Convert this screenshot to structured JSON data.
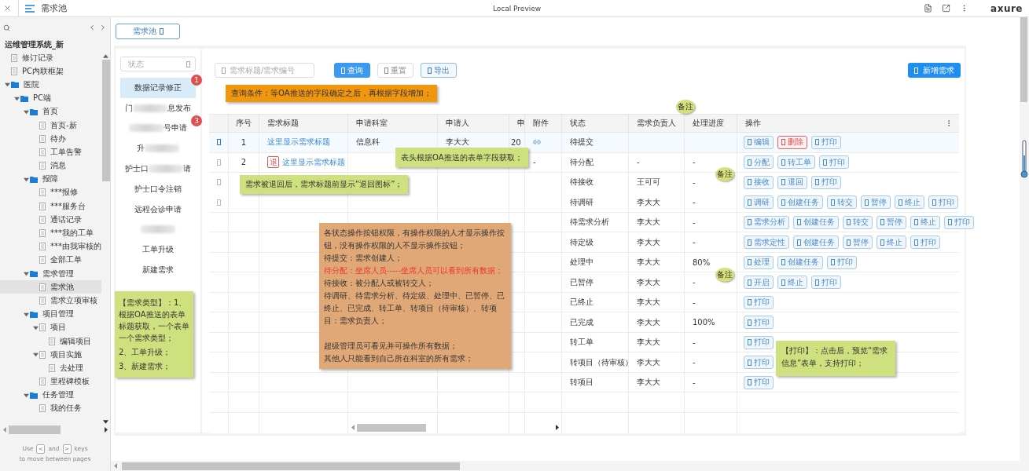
{
  "topbar": {
    "page_title": "需求池",
    "center_title": "Local Preview",
    "logo": "axure"
  },
  "sidebar": {
    "project_title": "运维管理系统_新",
    "tree": [
      {
        "label": "修订记录",
        "kind": "page",
        "selected": false
      },
      {
        "label": "PC内联框架",
        "kind": "page",
        "selected": false
      },
      {
        "label": "医院",
        "kind": "folder",
        "expanded": true,
        "selected": false,
        "children": [
          {
            "label": "PC端",
            "kind": "folder",
            "expanded": true,
            "selected": false,
            "children": [
              {
                "label": "首页",
                "kind": "folder",
                "expanded": true,
                "selected": false,
                "children": [
                  {
                    "label": "首页-新",
                    "kind": "page",
                    "selected": false
                  },
                  {
                    "label": "待办",
                    "kind": "page",
                    "selected": false
                  },
                  {
                    "label": "工单告警",
                    "kind": "page",
                    "selected": false
                  },
                  {
                    "label": "消息",
                    "kind": "page",
                    "selected": false
                  }
                ]
              },
              {
                "label": "报障",
                "kind": "folder",
                "expanded": true,
                "selected": false,
                "children": [
                  {
                    "label": "***报修",
                    "kind": "page",
                    "selected": false
                  },
                  {
                    "label": "***服务台",
                    "kind": "page",
                    "selected": false
                  },
                  {
                    "label": "通话记录",
                    "kind": "page",
                    "selected": false
                  },
                  {
                    "label": "***我的工单",
                    "kind": "page",
                    "selected": false
                  },
                  {
                    "label": "***由我审核的",
                    "kind": "page",
                    "selected": false
                  },
                  {
                    "label": "全部工单",
                    "kind": "page",
                    "selected": false
                  }
                ]
              },
              {
                "label": "需求管理",
                "kind": "folder",
                "expanded": true,
                "selected": false,
                "children": [
                  {
                    "label": "需求池",
                    "kind": "page",
                    "selected": true
                  },
                  {
                    "label": "需求立项审核",
                    "kind": "page",
                    "selected": false
                  }
                ]
              },
              {
                "label": "项目管理",
                "kind": "folder",
                "expanded": true,
                "selected": false,
                "children": [
                  {
                    "label": "项目",
                    "kind": "page",
                    "expanded": true,
                    "selected": false,
                    "children": [
                      {
                        "label": "编辑项目",
                        "kind": "page",
                        "selected": false
                      }
                    ]
                  },
                  {
                    "label": "项目实施",
                    "kind": "page",
                    "expanded": true,
                    "selected": false,
                    "children": [
                      {
                        "label": "去处理",
                        "kind": "page",
                        "selected": false
                      }
                    ]
                  },
                  {
                    "label": "里程碑模板",
                    "kind": "page",
                    "selected": false
                  }
                ]
              },
              {
                "label": "任务管理",
                "kind": "folder",
                "expanded": true,
                "selected": false,
                "children": [
                  {
                    "label": "我的任务",
                    "kind": "page",
                    "selected": false
                  }
                ]
              }
            ]
          }
        ]
      }
    ],
    "footer": {
      "use": "Use",
      "prev_key": "<",
      "and": "and",
      "next_key": ">",
      "keys": "keys",
      "line2": "to move between pages"
    }
  },
  "tab": {
    "label": "需求池",
    "selected": true
  },
  "left_panel": {
    "filter": {
      "placeholder": "状态"
    },
    "items": [
      {
        "selected": true,
        "badge": "1",
        "segments": [
          {
            "kind": "text",
            "text": "数据记录修正"
          }
        ]
      },
      {
        "selected": false,
        "segments": [
          {
            "kind": "text",
            "text": "门"
          },
          {
            "kind": "blur"
          },
          {
            "kind": "text",
            "text": "息发布"
          }
        ]
      },
      {
        "selected": false,
        "badge": "3",
        "segments": [
          {
            "kind": "blur"
          },
          {
            "kind": "text",
            "text": "号申请"
          }
        ]
      },
      {
        "selected": false,
        "segments": [
          {
            "kind": "text",
            "text": "升"
          },
          {
            "kind": "blur"
          }
        ]
      },
      {
        "selected": false,
        "segments": [
          {
            "kind": "text",
            "text": "护士口"
          },
          {
            "kind": "blur"
          },
          {
            "kind": "text",
            "text": "请"
          }
        ]
      },
      {
        "selected": false,
        "segments": [
          {
            "kind": "text",
            "text": "护士口令注销"
          }
        ]
      },
      {
        "selected": false,
        "segments": [
          {
            "kind": "text",
            "text": "远程会诊申请"
          }
        ]
      },
      {
        "selected": false,
        "segments": [
          {
            "kind": "blur"
          }
        ]
      },
      {
        "selected": false,
        "segments": [
          {
            "kind": "text",
            "text": "工单升级"
          }
        ]
      },
      {
        "selected": false,
        "segments": [
          {
            "kind": "text",
            "text": "新建需求"
          }
        ]
      }
    ],
    "note": {
      "text": "【需求类型】：1、根据OA推送的表单标题获取，一个表单一个需求类型；",
      "lines": [
        "2、工单升级；",
        "3、新建需求；"
      ]
    }
  },
  "toolbar": {
    "search": {
      "placeholder": "需求标题/需求编号"
    },
    "buttons": [
      {
        "label": "查询",
        "kind": "primary"
      },
      {
        "label": "重置",
        "kind": "default"
      },
      {
        "label": "导出",
        "kind": "outline"
      }
    ],
    "add_button": {
      "label": "新增需求"
    },
    "note": "查询条件：等OA推送的字段确定之后，再根据字段增加；"
  },
  "table": {
    "columns": [
      "序号",
      "需求标题",
      "申请科室",
      "申请人",
      "申",
      "附件",
      "状态",
      "需求负责人",
      "处理进度",
      "操作"
    ],
    "rows": [
      {
        "selected": true,
        "no": "1",
        "title": "这里显示需求标题",
        "department": "信息科",
        "applicant": "李大大",
        "date": "20",
        "attachment_link": true,
        "status": "待提交",
        "actions": [
          {
            "label": "编辑",
            "kind": "default"
          },
          {
            "label": "删除",
            "kind": "danger"
          },
          {
            "label": "打印",
            "kind": "default"
          }
        ]
      },
      {
        "selected": false,
        "no": "2",
        "return_tag": "退",
        "title": "这里显示需求标题",
        "attachment": "-",
        "status": "待分配",
        "owner": "-",
        "progress": "-",
        "actions": [
          {
            "label": "分配",
            "kind": "default"
          },
          {
            "label": "转工单",
            "kind": "default"
          },
          {
            "label": "打印",
            "kind": "default"
          }
        ]
      },
      {
        "selected": false,
        "status": "待接收",
        "owner": "王可可",
        "progress": "-",
        "actions": [
          {
            "label": "接收",
            "kind": "default"
          },
          {
            "label": "退回",
            "kind": "default"
          },
          {
            "label": "打印",
            "kind": "default"
          }
        ]
      },
      {
        "selected": false,
        "status": "待调研",
        "owner": "李大大",
        "progress": "-",
        "actions": [
          {
            "label": "调研",
            "kind": "default"
          },
          {
            "label": "创建任务",
            "kind": "default"
          },
          {
            "label": "转交",
            "kind": "default"
          },
          {
            "label": "暂停",
            "kind": "default"
          },
          {
            "label": "终止",
            "kind": "default"
          },
          {
            "label": "打印",
            "kind": "default"
          }
        ]
      },
      {
        "status": "待需求分析",
        "owner": "李大大",
        "progress": "-",
        "actions": [
          {
            "label": "需求分析",
            "kind": "default"
          },
          {
            "label": "创建任务",
            "kind": "default"
          },
          {
            "label": "转交",
            "kind": "default"
          },
          {
            "label": "暂停",
            "kind": "default"
          },
          {
            "label": "终止",
            "kind": "default"
          },
          {
            "label": "打印",
            "kind": "default"
          }
        ]
      },
      {
        "status": "待定级",
        "owner": "李大大",
        "progress": "-",
        "actions": [
          {
            "label": "需求定性",
            "kind": "default"
          },
          {
            "label": "创建任务",
            "kind": "default"
          },
          {
            "label": "暂停",
            "kind": "default"
          },
          {
            "label": "终止",
            "kind": "default"
          },
          {
            "label": "打印",
            "kind": "default"
          }
        ]
      },
      {
        "status": "处理中",
        "owner": "李大大",
        "progress": "80%",
        "actions": [
          {
            "label": "处理",
            "kind": "default"
          },
          {
            "label": "创建任务",
            "kind": "default"
          },
          {
            "label": "打印",
            "kind": "default"
          }
        ]
      },
      {
        "status": "已暂停",
        "owner": "李大大",
        "progress": "-",
        "actions": [
          {
            "label": "开启",
            "kind": "default"
          },
          {
            "label": "终止",
            "kind": "default"
          },
          {
            "label": "打印",
            "kind": "default"
          }
        ]
      },
      {
        "status": "已终止",
        "owner": "李大大",
        "progress": "-",
        "actions": [
          {
            "label": "打印",
            "kind": "default"
          }
        ]
      },
      {
        "status": "已完成",
        "owner": "李大大",
        "progress": "100%",
        "actions": [
          {
            "label": "打印",
            "kind": "default"
          }
        ]
      },
      {
        "status": "转工单",
        "owner": "李大大",
        "progress": "-",
        "actions": [
          {
            "label": "打印",
            "kind": "default"
          }
        ]
      },
      {
        "status": "转项目（待审核）",
        "owner": "李大大",
        "progress": "-",
        "actions": [
          {
            "label": "打印",
            "kind": "default"
          }
        ]
      },
      {
        "status": "转项目",
        "owner": "李大大",
        "progress": "-",
        "actions": [
          {
            "label": "打印",
            "kind": "default"
          }
        ]
      }
    ],
    "header_note": "表头根据OA推送的表单字段获取；",
    "returned_note": "需求被退回后，需求标题前显示“退回图标”；",
    "permissions_note": [
      {
        "kind": "plain",
        "text": "各状态操作按钮权限，有操作权限的人才显示操作按钮，没有操作权限的人不显示操作按钮；"
      },
      {
        "kind": "plain",
        "text": "待提交：需求创建人；"
      },
      {
        "kind": "alert",
        "text": "待分配：坐席人员-----坐席人员可以看到所有数据；"
      },
      {
        "kind": "plain",
        "text": "待接收：被分配人或被转交人；"
      },
      {
        "kind": "plain",
        "text": "待调研、待需求分析、待定级、处理中、已暂停、已终止、已完成、转工单、转项目（待审核）、转项目：需求负责人；"
      },
      {
        "kind": "gap",
        "text": "超级管理员可看见并可操作所有数据；"
      },
      {
        "kind": "plain",
        "text": "其他人只能看到自己所在科室的所有需求；"
      }
    ],
    "print_note": "【打印】：点击后，预览“需求信息”表单，支持打印；",
    "remark_tags": [
      "备注",
      "备注",
      "备注"
    ]
  }
}
